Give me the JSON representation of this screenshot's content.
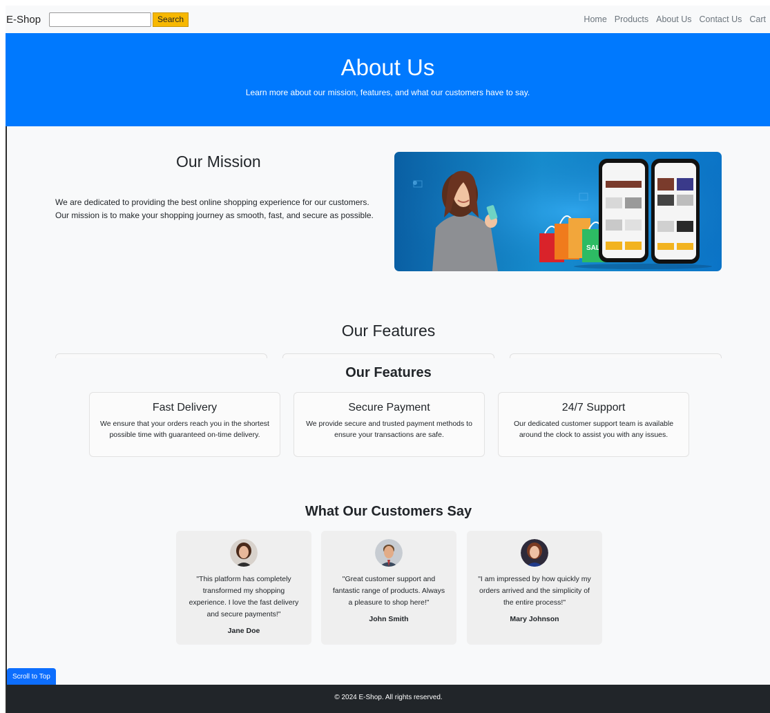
{
  "navbar": {
    "brand": "E-Shop",
    "search_placeholder": "",
    "search_button": "Search",
    "links": [
      "Home",
      "Products",
      "About Us",
      "Contact Us",
      "Cart"
    ]
  },
  "hero": {
    "title": "About Us",
    "subtitle": "Learn more about our mission, features, and what our customers have to say."
  },
  "mission": {
    "title": "Our Mission",
    "text": "We are dedicated to providing the best online shopping experience for our customers. Our mission is to make your shopping journey as smooth, fast, and secure as possible.",
    "image_badge": "SALE"
  },
  "features": {
    "title": "Our Features",
    "items": [
      {
        "title": "Fast Delivery",
        "text": "We ensure that your orders reach you in the shortest possible time with guaranteed on-time delivery."
      },
      {
        "title": "Secure Payment",
        "text": "We provide secure and trusted payment methods to ensure your transactions are safe."
      },
      {
        "title": "24/7 Support",
        "text": "Our dedicated customer support team is available around the clock to assist you with any issues."
      }
    ]
  },
  "testimonials": {
    "title": "What Our Customers Say",
    "items": [
      {
        "quote": "\"This platform has completely transformed my shopping experience. I love the fast delivery and secure payments!\"",
        "name": "Jane Doe"
      },
      {
        "quote": "\"Great customer support and fantastic range of products. Always a pleasure to shop here!\"",
        "name": "John Smith"
      },
      {
        "quote": "\"I am impressed by how quickly my orders arrived and the simplicity of the entire process!\"",
        "name": "Mary Johnson"
      }
    ]
  },
  "scroll_top": "Scroll to Top",
  "footer": "© 2024 E-Shop. All rights reserved.",
  "colors": {
    "hero": "#0079fe",
    "search_button": "#f7b801",
    "footer": "#212529",
    "scroll_button": "#0d6efd"
  }
}
